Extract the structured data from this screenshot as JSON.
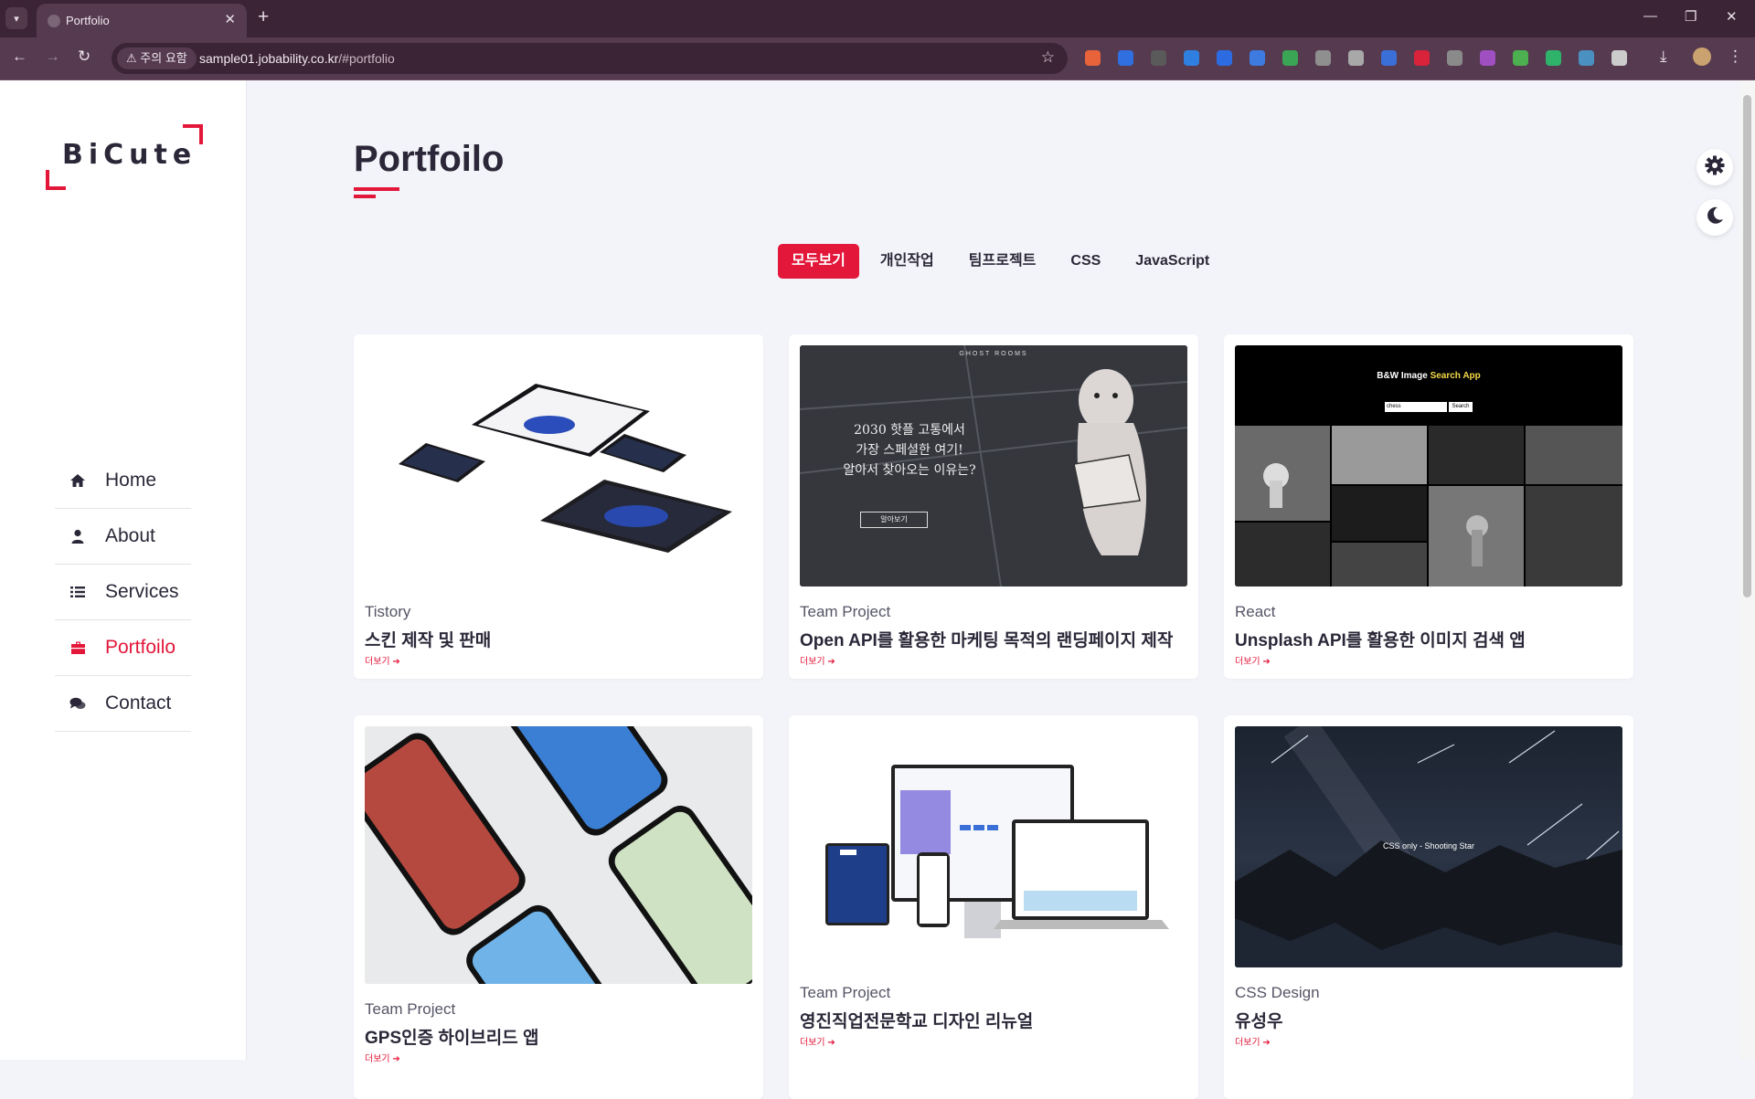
{
  "browser": {
    "tab_title": "Portfolio",
    "security_label": "주의 요함",
    "url_host": "sample01.jobability.co.kr",
    "url_path": "/#portfolio",
    "extensions": [
      "rx-icon",
      "info-icon",
      "s-icon",
      "shield-icon",
      "zoom-icon",
      "link-icon",
      "play-icon",
      "react-icon",
      "gear-ext-icon",
      "pen-icon",
      "record-icon",
      "ci-icon",
      "lb-icon",
      "card-icon",
      "chat-icon",
      "grid-icon",
      "puzzle-icon"
    ]
  },
  "sidebar": {
    "logo": "BiCute",
    "items": [
      {
        "label": "Home",
        "icon": "home-icon"
      },
      {
        "label": "About",
        "icon": "user-icon"
      },
      {
        "label": "Services",
        "icon": "list-icon"
      },
      {
        "label": "Portfoilo",
        "icon": "briefcase-icon"
      },
      {
        "label": "Contact",
        "icon": "comments-icon"
      }
    ]
  },
  "main": {
    "title": "Portfoilo",
    "filters": [
      "모두보기",
      "개인작업",
      "팀프로젝트",
      "CSS",
      "JavaScript"
    ],
    "active_filter": "모두보기"
  },
  "cards": [
    {
      "category": "Tistory",
      "title": "스킨 제작 및 판매",
      "more": "더보기"
    },
    {
      "category": "Team Project",
      "title": "Open API를 활용한 마케팅 목적의 랜딩페이지 제작",
      "more": "더보기",
      "thumb_text": [
        "GHOST ROOMS",
        "2030 핫플 고통에서",
        "가장 스페셜한 여기!",
        "알아서 찾아오는 이유는?",
        "알아보기"
      ]
    },
    {
      "category": "React",
      "title": "Unsplash API를 활용한 이미지 검색 앱",
      "more": "더보기",
      "thumb_text": [
        "B&W Image",
        "Search App",
        "chess",
        "Search"
      ]
    },
    {
      "category": "Team Project",
      "title": "GPS인증 하이브리드 앱",
      "more": "더보기"
    },
    {
      "category": "Team Project",
      "title": "영진직업전문학교 디자인 리뉴얼",
      "more": "더보기"
    },
    {
      "category": "CSS Design",
      "title": "유성우",
      "more": "더보기",
      "thumb_text": [
        "CSS only - Shooting Star"
      ]
    }
  ],
  "colors": {
    "accent": "#e3173a",
    "text": "#2b2738",
    "chrome": "#3b2436"
  }
}
